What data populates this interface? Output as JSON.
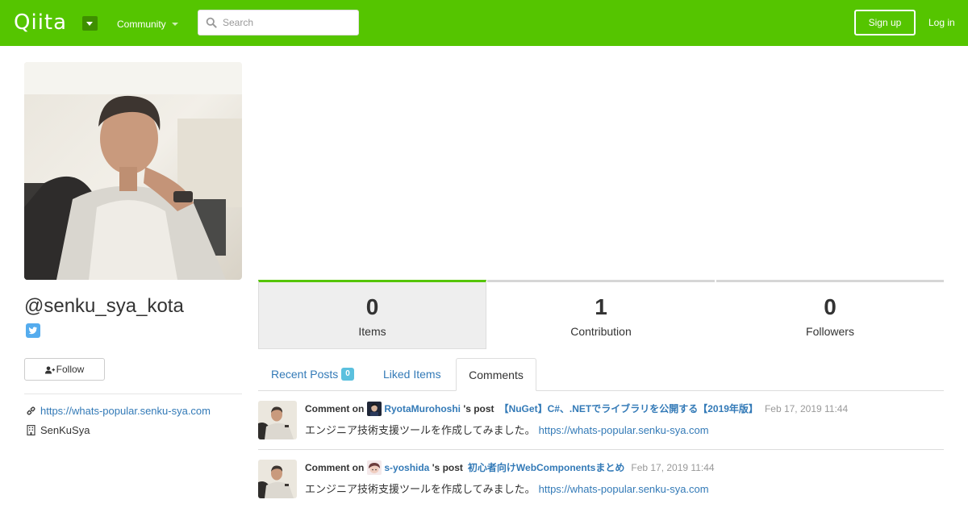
{
  "header": {
    "logo": "Qiita",
    "community_label": "Community",
    "search_placeholder": "Search",
    "signup_label": "Sign up",
    "login_label": "Log in",
    "brand_color": "#55c500"
  },
  "profile": {
    "username": "@senku_sya_kota",
    "follow_label": "Follow",
    "website": "https://whats-popular.senku-sya.com",
    "organization": "SenKuSya"
  },
  "stats": [
    {
      "value": "0",
      "label": "Items",
      "active": true
    },
    {
      "value": "1",
      "label": "Contribution",
      "active": false
    },
    {
      "value": "0",
      "label": "Followers",
      "active": false
    }
  ],
  "tabs": {
    "recent_posts": "Recent Posts",
    "recent_posts_count": "0",
    "liked_items": "Liked Items",
    "comments": "Comments"
  },
  "comments": [
    {
      "prefix": "Comment on",
      "user": "RyotaMurohoshi",
      "post_word": "'s post",
      "title": "【NuGet】C#、.NETでライブラリを公開する【2019年版】",
      "time": "Feb 17, 2019 11:44",
      "body": "エンジニア技術支援ツールを作成してみました。",
      "body_link": "https://whats-popular.senku-sya.com"
    },
    {
      "prefix": "Comment on",
      "user": "s-yoshida",
      "post_word": "'s post",
      "title": "初心者向けWebComponentsまとめ",
      "time": "Feb 17, 2019 11:44",
      "body": "エンジニア技術支援ツールを作成してみました。",
      "body_link": "https://whats-popular.senku-sya.com"
    }
  ]
}
